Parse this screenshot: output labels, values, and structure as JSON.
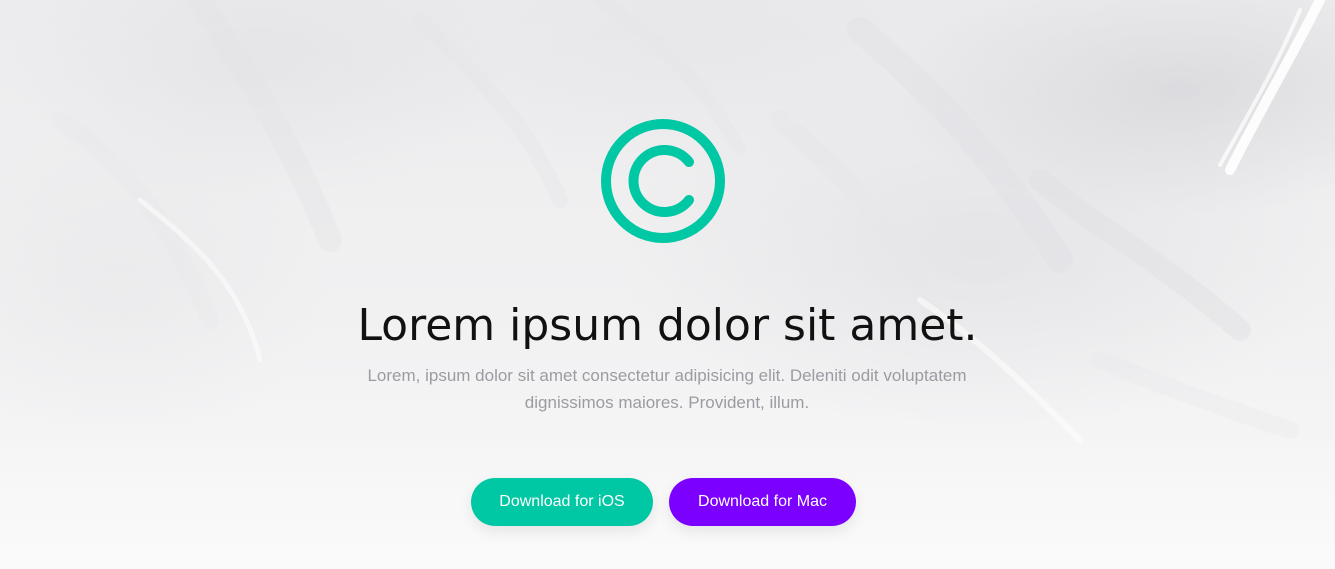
{
  "hero": {
    "logo_icon": "copyright-icon",
    "title": "Lorem ipsum dolor sit amet.",
    "subtitle": "Lorem, ipsum dolor sit amet consectetur adipisicing elit. Deleniti odit voluptatem dignissimos maiores. Provident, illum."
  },
  "buttons": {
    "ios_label": "Download for iOS",
    "mac_label": "Download for Mac"
  },
  "colors": {
    "accent": "#00c7a4",
    "secondary": "#7b00ff",
    "title": "#111111",
    "subtitle": "#9b9ba2",
    "background": "#f1f1f2"
  }
}
